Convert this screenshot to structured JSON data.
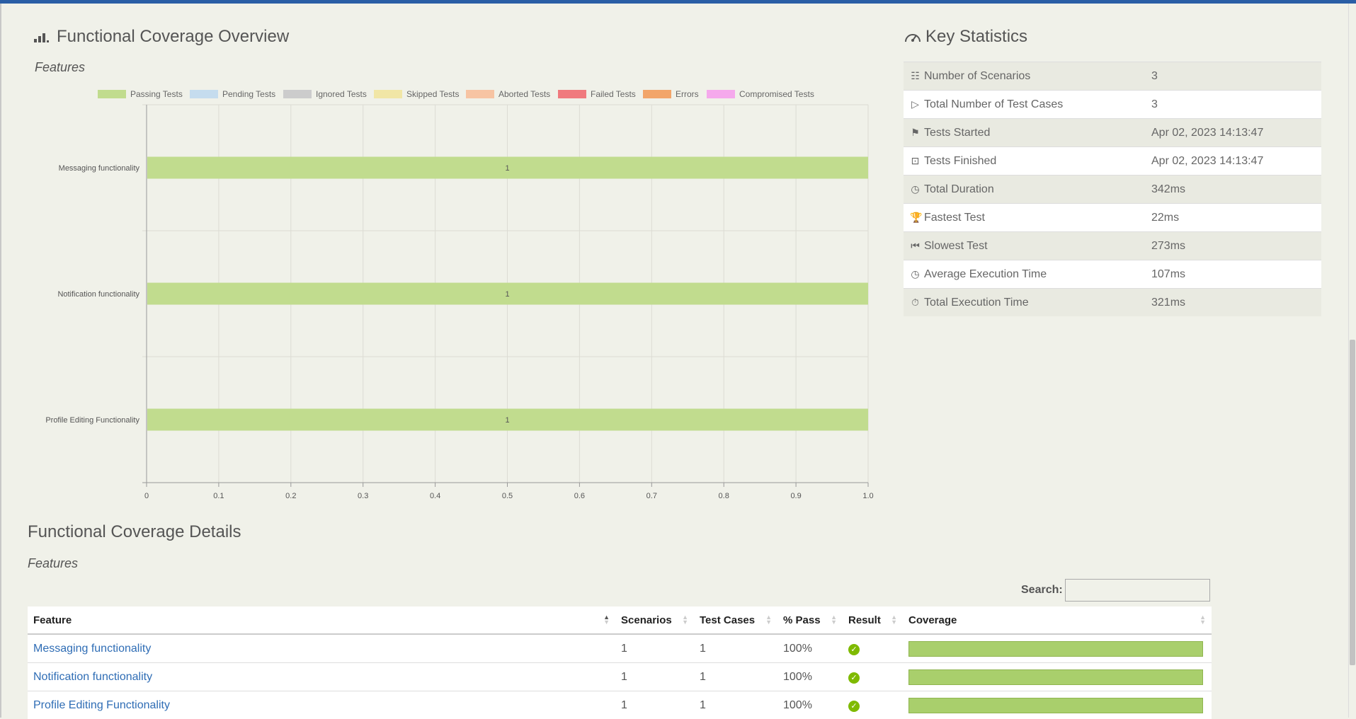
{
  "overview": {
    "title": "Functional Coverage Overview",
    "subtitle": "Features"
  },
  "legend": [
    {
      "label": "Passing Tests",
      "color": "#c1dc8e"
    },
    {
      "label": "Pending Tests",
      "color": "#c5dcee"
    },
    {
      "label": "Ignored Tests",
      "color": "#cccccc"
    },
    {
      "label": "Skipped Tests",
      "color": "#f1e6a6"
    },
    {
      "label": "Aborted Tests",
      "color": "#f7c4a3"
    },
    {
      "label": "Failed Tests",
      "color": "#f07a7e"
    },
    {
      "label": "Errors",
      "color": "#f2a56a"
    },
    {
      "label": "Compromised Tests",
      "color": "#f5a9ec"
    }
  ],
  "chart_data": {
    "type": "bar",
    "orientation": "horizontal",
    "categories": [
      "Messaging functionality",
      "Notification functionality",
      "Profile Editing Functionality"
    ],
    "series": [
      {
        "name": "Passing Tests",
        "values": [
          1,
          1,
          1
        ]
      }
    ],
    "data_labels": [
      "1",
      "1",
      "1"
    ],
    "xlim": [
      0,
      1.0
    ],
    "x_ticks": [
      "0",
      "0.1",
      "0.2",
      "0.3",
      "0.4",
      "0.5",
      "0.6",
      "0.7",
      "0.8",
      "0.9",
      "1.0"
    ],
    "grid": true,
    "legend_position": "top"
  },
  "key_statistics": {
    "title": "Key Statistics",
    "rows": [
      {
        "icon": "list-icon",
        "label": "Number of Scenarios",
        "value": "3"
      },
      {
        "icon": "play-icon",
        "label": "Total Number of Test Cases",
        "value": "3"
      },
      {
        "icon": "flag-icon",
        "label": "Tests Started",
        "value": "Apr 02, 2023 14:13:47"
      },
      {
        "icon": "stop-icon",
        "label": "Tests Finished",
        "value": "Apr 02, 2023 14:13:47"
      },
      {
        "icon": "timer-icon",
        "label": "Total Duration",
        "value": "342ms"
      },
      {
        "icon": "trophy-icon",
        "label": "Fastest Test",
        "value": "22ms"
      },
      {
        "icon": "skip-back-icon",
        "label": "Slowest Test",
        "value": "273ms"
      },
      {
        "icon": "timer-icon",
        "label": "Average Execution Time",
        "value": "107ms"
      },
      {
        "icon": "stopwatch-icon",
        "label": "Total Execution Time",
        "value": "321ms"
      }
    ]
  },
  "details": {
    "title": "Functional Coverage Details",
    "subtitle": "Features",
    "search_label": "Search:",
    "columns": [
      "Feature",
      "Scenarios",
      "Test Cases",
      "% Pass",
      "Result",
      "Coverage"
    ],
    "rows": [
      {
        "feature": "Messaging functionality",
        "scenarios": "1",
        "test_cases": "1",
        "pass": "100%",
        "result": "passed",
        "coverage": 1.0
      },
      {
        "feature": "Notification functionality",
        "scenarios": "1",
        "test_cases": "1",
        "pass": "100%",
        "result": "passed",
        "coverage": 1.0
      },
      {
        "feature": "Profile Editing Functionality",
        "scenarios": "1",
        "test_cases": "1",
        "pass": "100%",
        "result": "passed",
        "coverage": 1.0
      }
    ]
  }
}
